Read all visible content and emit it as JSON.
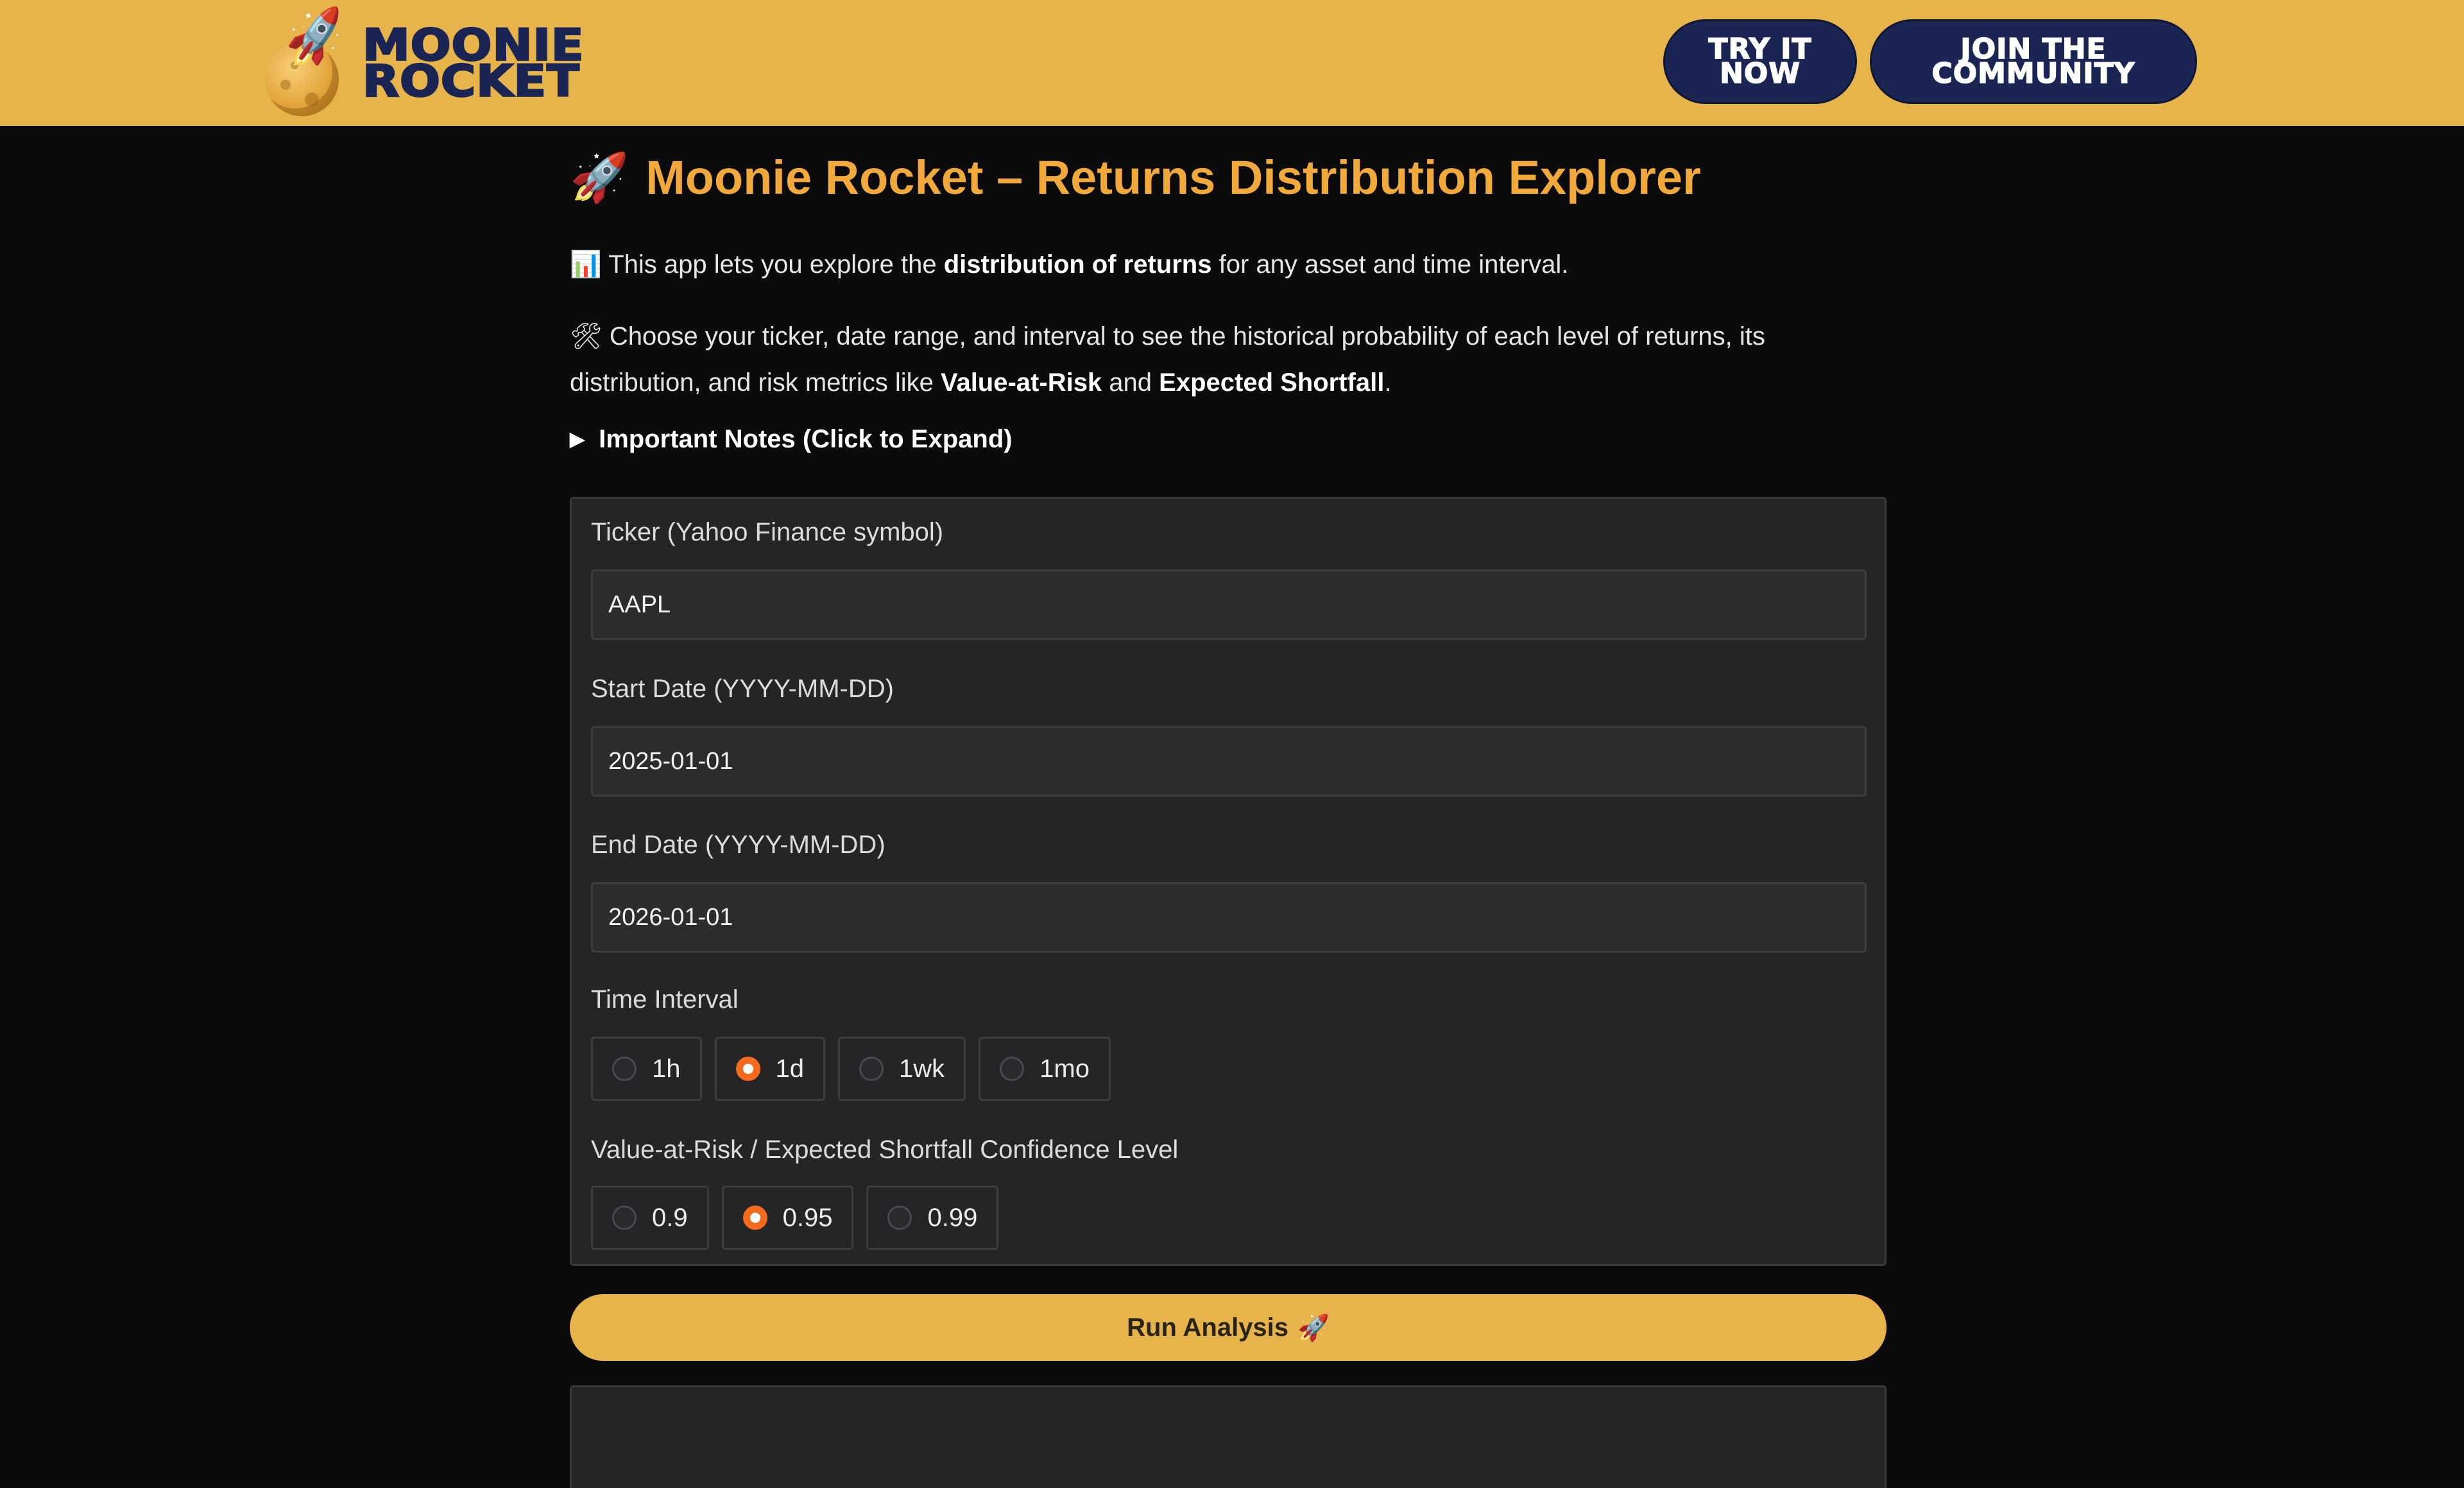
{
  "header": {
    "logo_line1": "MOONIE",
    "logo_line2": "ROCKET",
    "try_line1": "TRY IT",
    "try_line2": "NOW",
    "join_line1": "JOIN THE",
    "join_line2": "COMMUNITY",
    "color_bg": "#e7b34b",
    "color_button": "#1b2553"
  },
  "main": {
    "title_emoji": "🚀",
    "title": "Moonie Rocket – Returns Distribution Explorer",
    "intro": {
      "emoji": "📊",
      "pre": " This app lets you explore the ",
      "bold": "distribution of returns",
      "post": " for any asset and time interval."
    },
    "instructions": {
      "emoji": "🛠",
      "pre": " Choose your ticker, date range, and interval to see the historical probability of each level of returns, its distribution, and risk metrics like ",
      "bold1": "Value-at-Risk",
      "mid": " and ",
      "bold2": "Expected Shortfall",
      "post": "."
    },
    "notes_label": "Important Notes (Click to Expand)"
  },
  "form": {
    "ticker_label": "Ticker (Yahoo Finance symbol)",
    "ticker_value": "AAPL",
    "start_label": "Start Date (YYYY-MM-DD)",
    "start_value": "2025-01-01",
    "end_label": "End Date (YYYY-MM-DD)",
    "end_value": "2026-01-01",
    "interval_label": "Time Interval",
    "interval_options": [
      "1h",
      "1d",
      "1wk",
      "1mo"
    ],
    "interval_selected": "1d",
    "confidence_label": "Value-at-Risk / Expected Shortfall Confidence Level",
    "confidence_options": [
      "0.9",
      "0.95",
      "0.99"
    ],
    "confidence_selected": "0.95",
    "accent_color": "#f36a1c"
  },
  "run_button": {
    "label": "Run Analysis",
    "emoji": "🚀"
  }
}
